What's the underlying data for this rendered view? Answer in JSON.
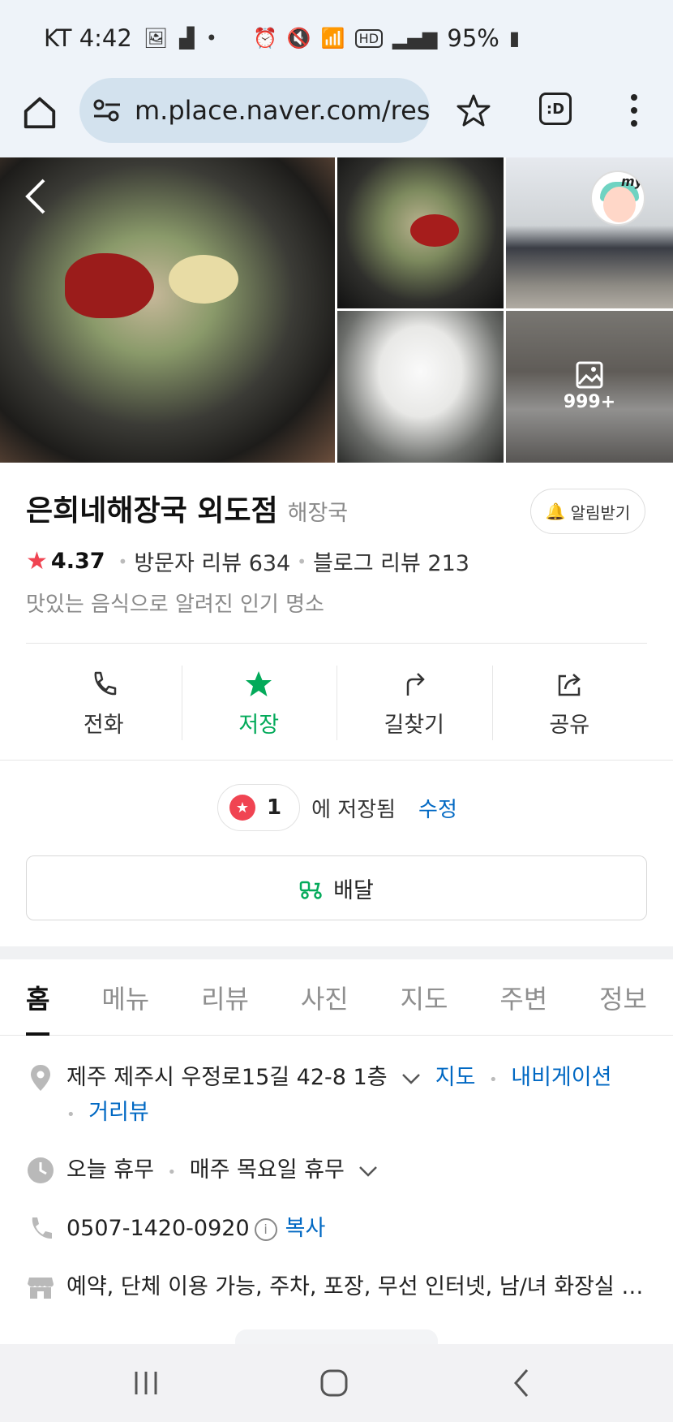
{
  "status_bar": {
    "carrier_time": "KT 4:42",
    "battery": "95%"
  },
  "browser": {
    "url": "m.place.naver.com/rest",
    "tab_label": ":D"
  },
  "photos": {
    "more_count": "999+",
    "my_badge": "my"
  },
  "place": {
    "name": "은희네해장국 외도점",
    "category": "해장국",
    "alert_label": "알림받기",
    "rating": "4.37",
    "visitor_reviews": "방문자 리뷰 634",
    "blog_reviews": "블로그 리뷰 213",
    "description": "맛있는 음식으로 알려진 인기 명소"
  },
  "actions": [
    {
      "label": "전화",
      "icon": "phone-icon"
    },
    {
      "label": "저장",
      "icon": "star-icon"
    },
    {
      "label": "길찾기",
      "icon": "directions-icon"
    },
    {
      "label": "공유",
      "icon": "share-icon"
    }
  ],
  "saved": {
    "count": "1",
    "text": "에 저장됨",
    "edit": "수정"
  },
  "delivery": {
    "label": "배달"
  },
  "tabs": [
    "홈",
    "메뉴",
    "리뷰",
    "사진",
    "지도",
    "주변",
    "정보"
  ],
  "info": {
    "address": "제주 제주시 우정로15길 42-8 1층",
    "map_link": "지도",
    "navigation_link": "내비게이션",
    "street_view_link": "거리뷰",
    "hours_today": "오늘 휴무",
    "hours_detail": "매주 목요일 휴무",
    "phone": "0507-1420-0920",
    "copy_label": "복사",
    "amenities": "예약, 단체 이용 가능, 주차, 포장, 무선 인터넷, 남/녀 화장실 구분"
  },
  "colors": {
    "accent_green": "#03aa5a",
    "link_blue": "#0068c3",
    "star_red": "#f04452"
  }
}
